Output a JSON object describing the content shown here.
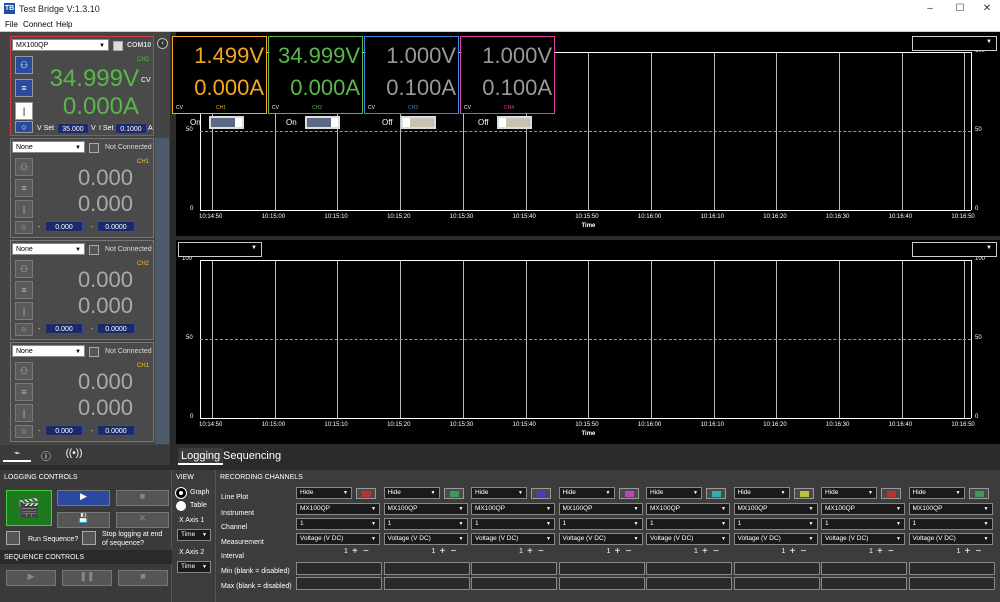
{
  "window": {
    "title": "Test Bridge V:1.3.10",
    "logo": "TB",
    "min": "–",
    "max": "☐",
    "close": "✕"
  },
  "menu": [
    "File",
    "Connect",
    "Help"
  ],
  "main_device": {
    "instrument": "MX100QP",
    "port": "COM10",
    "channel": "CH2",
    "voltage": "34.999V",
    "mode": "CV",
    "current": "0.000A",
    "vset_label": "V Set",
    "vset": "35.000",
    "vunit": "V",
    "iset_label": "I Set",
    "iset": "0.1000",
    "iunit": "A"
  },
  "devices": [
    {
      "instrument": "None",
      "status": "Not Connected",
      "channel": "CH1",
      "voltage": "0.000",
      "current": "0.000",
      "vset": "0.000",
      "iset": "0.0000"
    },
    {
      "instrument": "None",
      "status": "Not Connected",
      "channel": "CH2",
      "voltage": "0.000",
      "current": "0.000",
      "vset": "0.000",
      "iset": "0.0000"
    },
    {
      "instrument": "None",
      "status": "Not Connected",
      "channel": "CH1",
      "voltage": "0.000",
      "current": "0.000",
      "vset": "0.000",
      "iset": "0.0000"
    }
  ],
  "channel_cards": [
    {
      "voltage": "1.499V",
      "current": "0.000A",
      "mode": "CV",
      "ch": "CH1",
      "color": "#f5a623",
      "text_color": "#f5a623",
      "state": "On"
    },
    {
      "voltage": "34.999V",
      "current": "0.000A",
      "mode": "CV",
      "ch": "CH2",
      "color": "#5ab84a",
      "text_color": "#5ab84a",
      "state": "On"
    },
    {
      "voltage": "1.000V",
      "current": "0.100A",
      "mode": "CV",
      "ch": "CH3",
      "color": "#3a8ae0",
      "text_color": "#999999",
      "state": "Off"
    },
    {
      "voltage": "1.000V",
      "current": "0.100A",
      "mode": "CV",
      "ch": "CH4",
      "color": "#e040a0",
      "text_color": "#999999",
      "state": "Off"
    }
  ],
  "graph": {
    "y_ticks_top": [
      "100",
      "50"
    ],
    "y_ticks": [
      "100",
      "50",
      "0"
    ],
    "x_ticks": [
      "10:14:50",
      "10:15:00",
      "10:15:10",
      "10:15:20",
      "10:15:30",
      "10:15:40",
      "10:15:50",
      "10:16:00",
      "10:16:10",
      "10:16:20",
      "10:16:30",
      "10:16:40",
      "10:16:50"
    ],
    "xlabel": "Time"
  },
  "tabs": {
    "logging": "Logging",
    "sequencing": "Sequencing"
  },
  "logging_controls": {
    "header": "LOGGING CONTROLS",
    "run_sequence": "Run Sequence?",
    "stop_logging": "Stop logging at end of sequence?"
  },
  "sequence_controls": {
    "header": "SEQUENCE CONTROLS"
  },
  "view": {
    "header": "VIEW",
    "graph": "Graph",
    "table": "Table",
    "xaxis1": "X Axis 1",
    "xaxis2": "X Axis 2",
    "x1_value": "Time",
    "x2_value": "Time"
  },
  "recording": {
    "header": "RECORDING CHANNELS",
    "labels": [
      "Line Plot",
      "Instrument",
      "Channel",
      "Measurement",
      "Interval",
      "Min (blank = disabled)",
      "Max (blank = disabled)"
    ],
    "columns": [
      {
        "plot": "Hide",
        "instrument": "MX100QP",
        "channel": "1",
        "measurement": "Voltage (V DC)",
        "interval": "1",
        "color": "#c03030"
      },
      {
        "plot": "Hide",
        "instrument": "MX100QP",
        "channel": "1",
        "measurement": "Voltage (V DC)",
        "interval": "1",
        "color": "#3a9a5a"
      },
      {
        "plot": "Hide",
        "instrument": "MX100QP",
        "channel": "1",
        "measurement": "Voltage (V DC)",
        "interval": "1",
        "color": "#4040c0"
      },
      {
        "plot": "Hide",
        "instrument": "MX100QP",
        "channel": "1",
        "measurement": "Voltage (V DC)",
        "interval": "1",
        "color": "#c040c0"
      },
      {
        "plot": "Hide",
        "instrument": "MX100QP",
        "channel": "1",
        "measurement": "Voltage (V DC)",
        "interval": "1",
        "color": "#30b0b0"
      },
      {
        "plot": "Hide",
        "instrument": "MX100QP",
        "channel": "1",
        "measurement": "Voltage (V DC)",
        "interval": "1",
        "color": "#c0c040"
      },
      {
        "plot": "Hide",
        "instrument": "MX100QP",
        "channel": "1",
        "measurement": "Voltage (V DC)",
        "interval": "1",
        "color": "#c03030"
      },
      {
        "plot": "Hide",
        "instrument": "MX100QP",
        "channel": "1",
        "measurement": "Voltage (V DC)",
        "interval": "1",
        "color": "#3a9a5a"
      }
    ]
  }
}
